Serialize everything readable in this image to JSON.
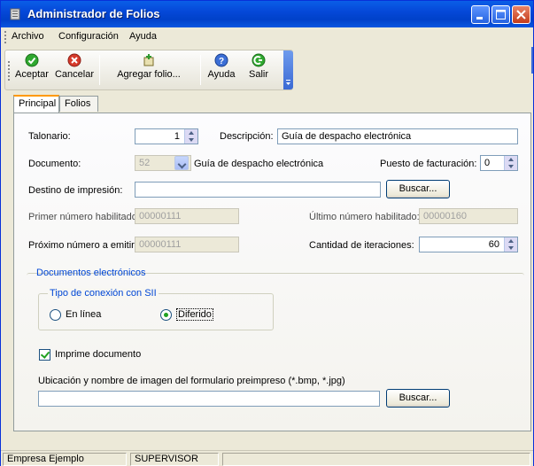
{
  "window": {
    "title": "Administrador de Folios",
    "title_bar_color": "#0054e3",
    "close_color": "#e0461f"
  },
  "menu": {
    "items": [
      "Archivo",
      "Configuración",
      "Ayuda"
    ]
  },
  "toolbar": {
    "accept_label": "Aceptar",
    "cancel_label": "Cancelar",
    "add_label": "Agregar folio...",
    "help_label": "Ayuda",
    "exit_label": "Salir"
  },
  "tabs": {
    "principal": "Principal",
    "folios": "Folios"
  },
  "form": {
    "talonario_label": "Talonario:",
    "talonario_value": "1",
    "descripcion_label": "Descripción:",
    "descripcion_value": "Guía de despacho electrónica",
    "documento_label": "Documento:",
    "documento_value": "52",
    "documento_desc": "Guía de despacho electrónica",
    "puesto_label": "Puesto de facturación:",
    "puesto_value": "0",
    "destino_label": "Destino de impresión:",
    "destino_value": "",
    "buscar_label": "Buscar...",
    "primer_label": "Primer número habilitado:",
    "primer_value": "00000111",
    "ultimo_label": "Último número habilitado:",
    "ultimo_value": "00000160",
    "proximo_label": "Próximo número a emitir:",
    "proximo_value": "00000111",
    "cantidad_label": "Cantidad de iteraciones:",
    "cantidad_value": "60"
  },
  "electronic": {
    "group_title": "Documentos electrónicos",
    "connection_title": "Tipo de conexión con SII",
    "online_label": "En línea",
    "deferred_label": "Diferido",
    "selected": "Diferido",
    "print_label": "Imprime documento",
    "print_checked": true,
    "image_label": "Ubicación y nombre de imagen del formulario preimpreso (*.bmp, *.jpg)",
    "image_value": "",
    "buscar_label": "Buscar..."
  },
  "status": {
    "company": "Empresa Ejemplo",
    "user": "SUPERVISOR"
  }
}
